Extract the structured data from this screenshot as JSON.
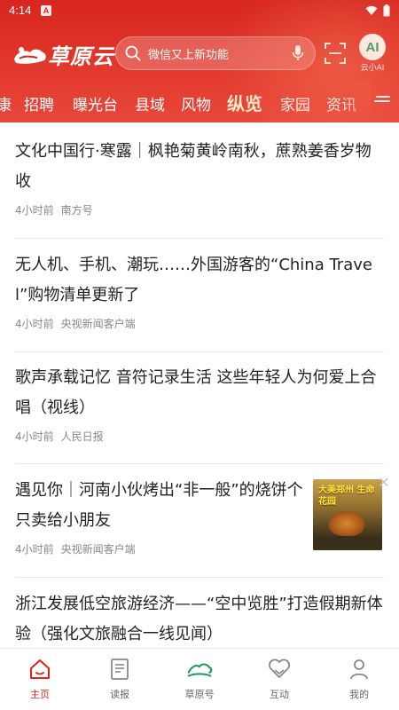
{
  "status_bar": {
    "time": "4:14",
    "app_icon": "A"
  },
  "header": {
    "logo_text": "草原云",
    "search_placeholder": "微信又上新功能",
    "ai_label": "云小AI",
    "ai_badge": "AI"
  },
  "tabs": [
    {
      "label": "康"
    },
    {
      "label": "招聘"
    },
    {
      "label": "曝光台"
    },
    {
      "label": "县域"
    },
    {
      "label": "风物"
    },
    {
      "label": "纵览",
      "active": true
    },
    {
      "label": "家园"
    },
    {
      "label": "资讯"
    }
  ],
  "news": [
    {
      "title": "文化中国行·寒露｜枫艳菊黄岭南秋，蔗熟姜香岁物收",
      "time": "4小时前",
      "source": "南方号"
    },
    {
      "title": "无人机、手机、潮玩……外国游客的“China Travel”购物清单更新了",
      "time": "4小时前",
      "source": "央视新闻客户端"
    },
    {
      "title": "歌声承载记忆 音符记录生活 这些年轻人为何爱上合唱（视线）",
      "time": "4小时前",
      "source": "人民日报"
    },
    {
      "title": "遇见你｜河南小伙烤出“非一般”的烧饼个只卖给小朋友",
      "time": "4小时前",
      "source": "央视新闻客户端",
      "thumb_text": "大美郑州 生命花园"
    },
    {
      "title": "浙江发展低空旅游经济——“空中览胜”打造假期新体验（强化文旅融合一线见闻）"
    }
  ],
  "bottom_nav": [
    {
      "label": "主页",
      "icon": "home-icon",
      "active": true
    },
    {
      "label": "读报",
      "icon": "newspaper-icon"
    },
    {
      "label": "草原号",
      "icon": "grassland-icon"
    },
    {
      "label": "互动",
      "icon": "interact-heart-icon"
    },
    {
      "label": "我的",
      "icon": "profile-icon"
    }
  ],
  "colors": {
    "brand_red": "#d7261f",
    "active_tab": "#ffe7c9",
    "nav_active": "#e2231a"
  }
}
